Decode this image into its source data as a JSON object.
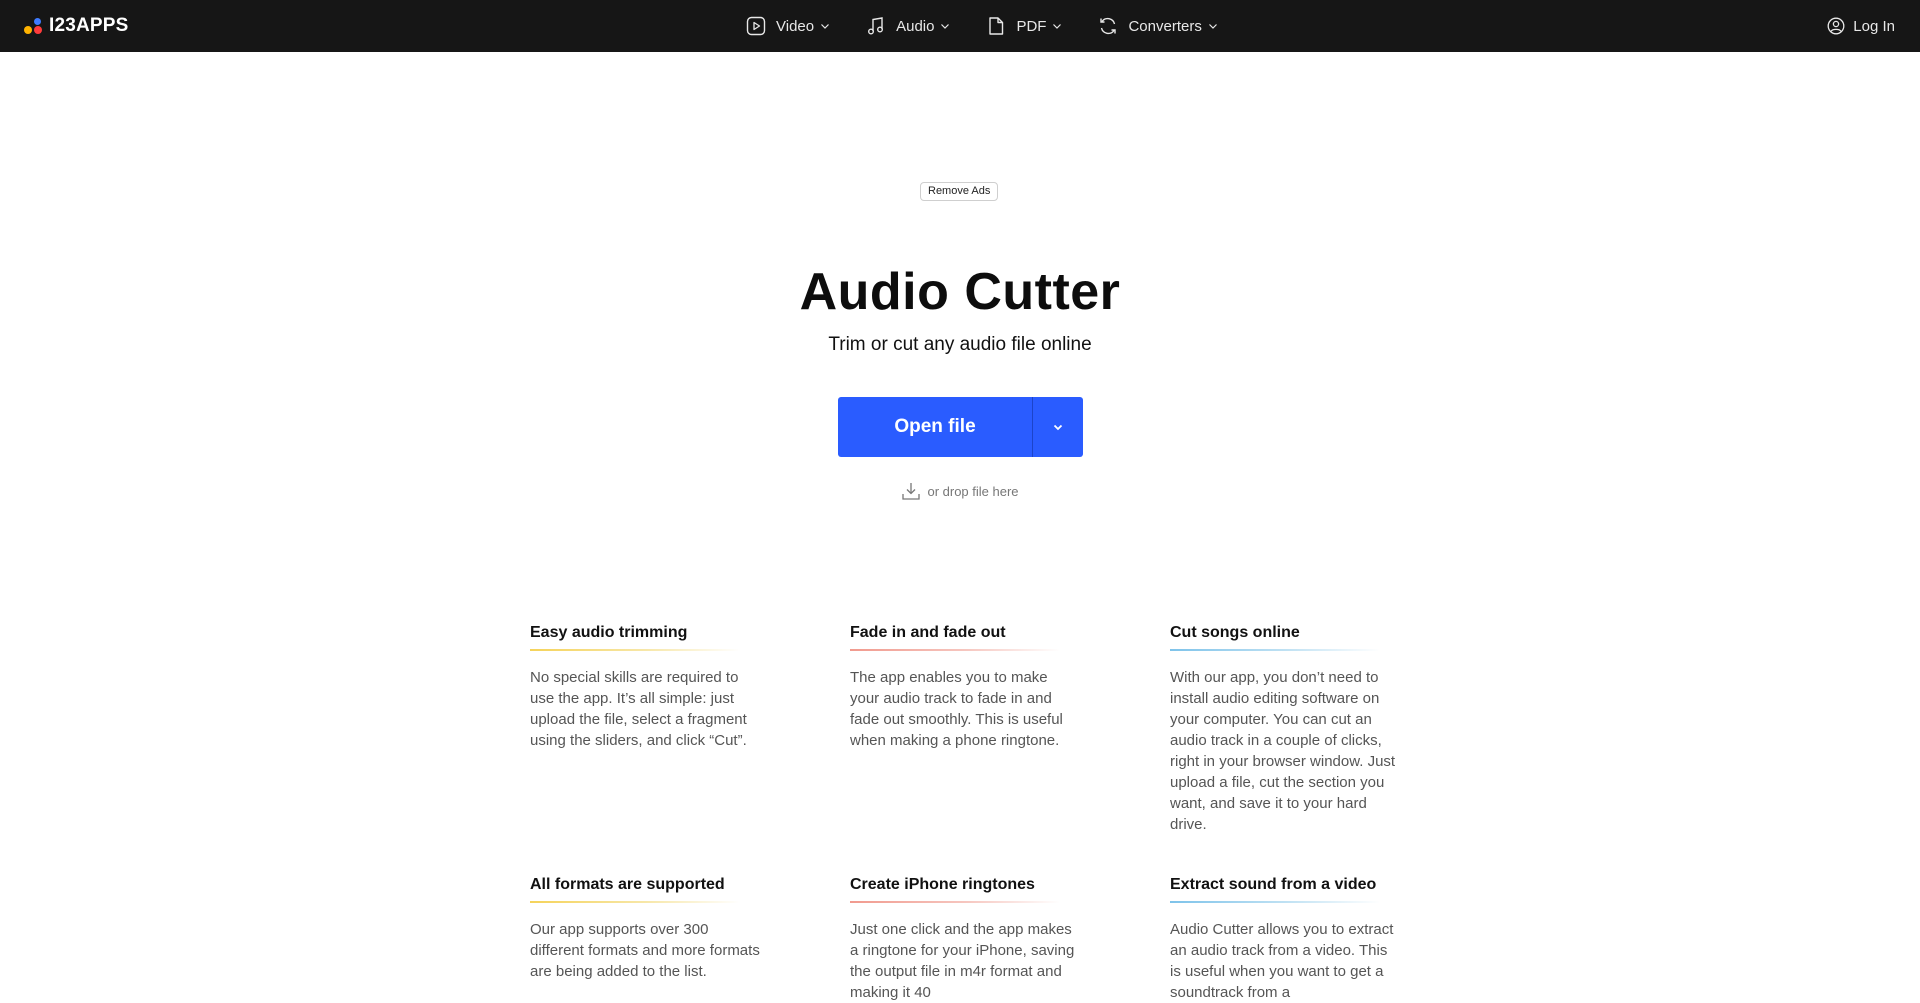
{
  "header": {
    "logo_text": "I23APPS",
    "nav": [
      {
        "label": "Video",
        "icon": "video-icon"
      },
      {
        "label": "Audio",
        "icon": "music-note-icon"
      },
      {
        "label": "PDF",
        "icon": "document-icon"
      },
      {
        "label": "Converters",
        "icon": "refresh-icon"
      }
    ],
    "login_label": "Log In"
  },
  "hero": {
    "remove_ads_label": "Remove Ads",
    "title": "Audio Cutter",
    "subtitle": "Trim or cut any audio file online",
    "open_file_label": "Open file",
    "drop_hint": "or drop file here"
  },
  "features": [
    {
      "title": "Easy audio trimming",
      "accent": "yellow",
      "text": "No special skills are required to use the app. It’s all simple: just upload the file, select a fragment using the sliders, and click “Cut”."
    },
    {
      "title": "Fade in and fade out",
      "accent": "red",
      "text": "The app enables you to make your audio track to fade in and fade out smoothly. This is useful when making a phone ringtone."
    },
    {
      "title": "Cut songs online",
      "accent": "blue",
      "text": "With our app, you don’t need to install audio editing software on your computer. You can cut an audio track in a couple of clicks, right in your browser window. Just upload a file, cut the section you want, and save it to your hard drive."
    },
    {
      "title": "All formats are supported",
      "accent": "yellow",
      "text": "Our app supports over 300 different formats and more formats are being added to the list."
    },
    {
      "title": "Create iPhone ringtones",
      "accent": "red",
      "text": "Just one click and the app makes a ringtone for your iPhone, saving the output file in m4r format and making it 40"
    },
    {
      "title": "Extract sound from a video",
      "accent": "blue",
      "text": "Audio Cutter allows you to extract an audio track from a video. This is useful when you want to get a soundtrack from a"
    }
  ],
  "colors": {
    "topbar": "#161616",
    "primary_button": "#2a5cff",
    "accent_yellow": "#f5d35a",
    "accent_red": "#f19a8e",
    "accent_blue": "#7ec3ea"
  }
}
